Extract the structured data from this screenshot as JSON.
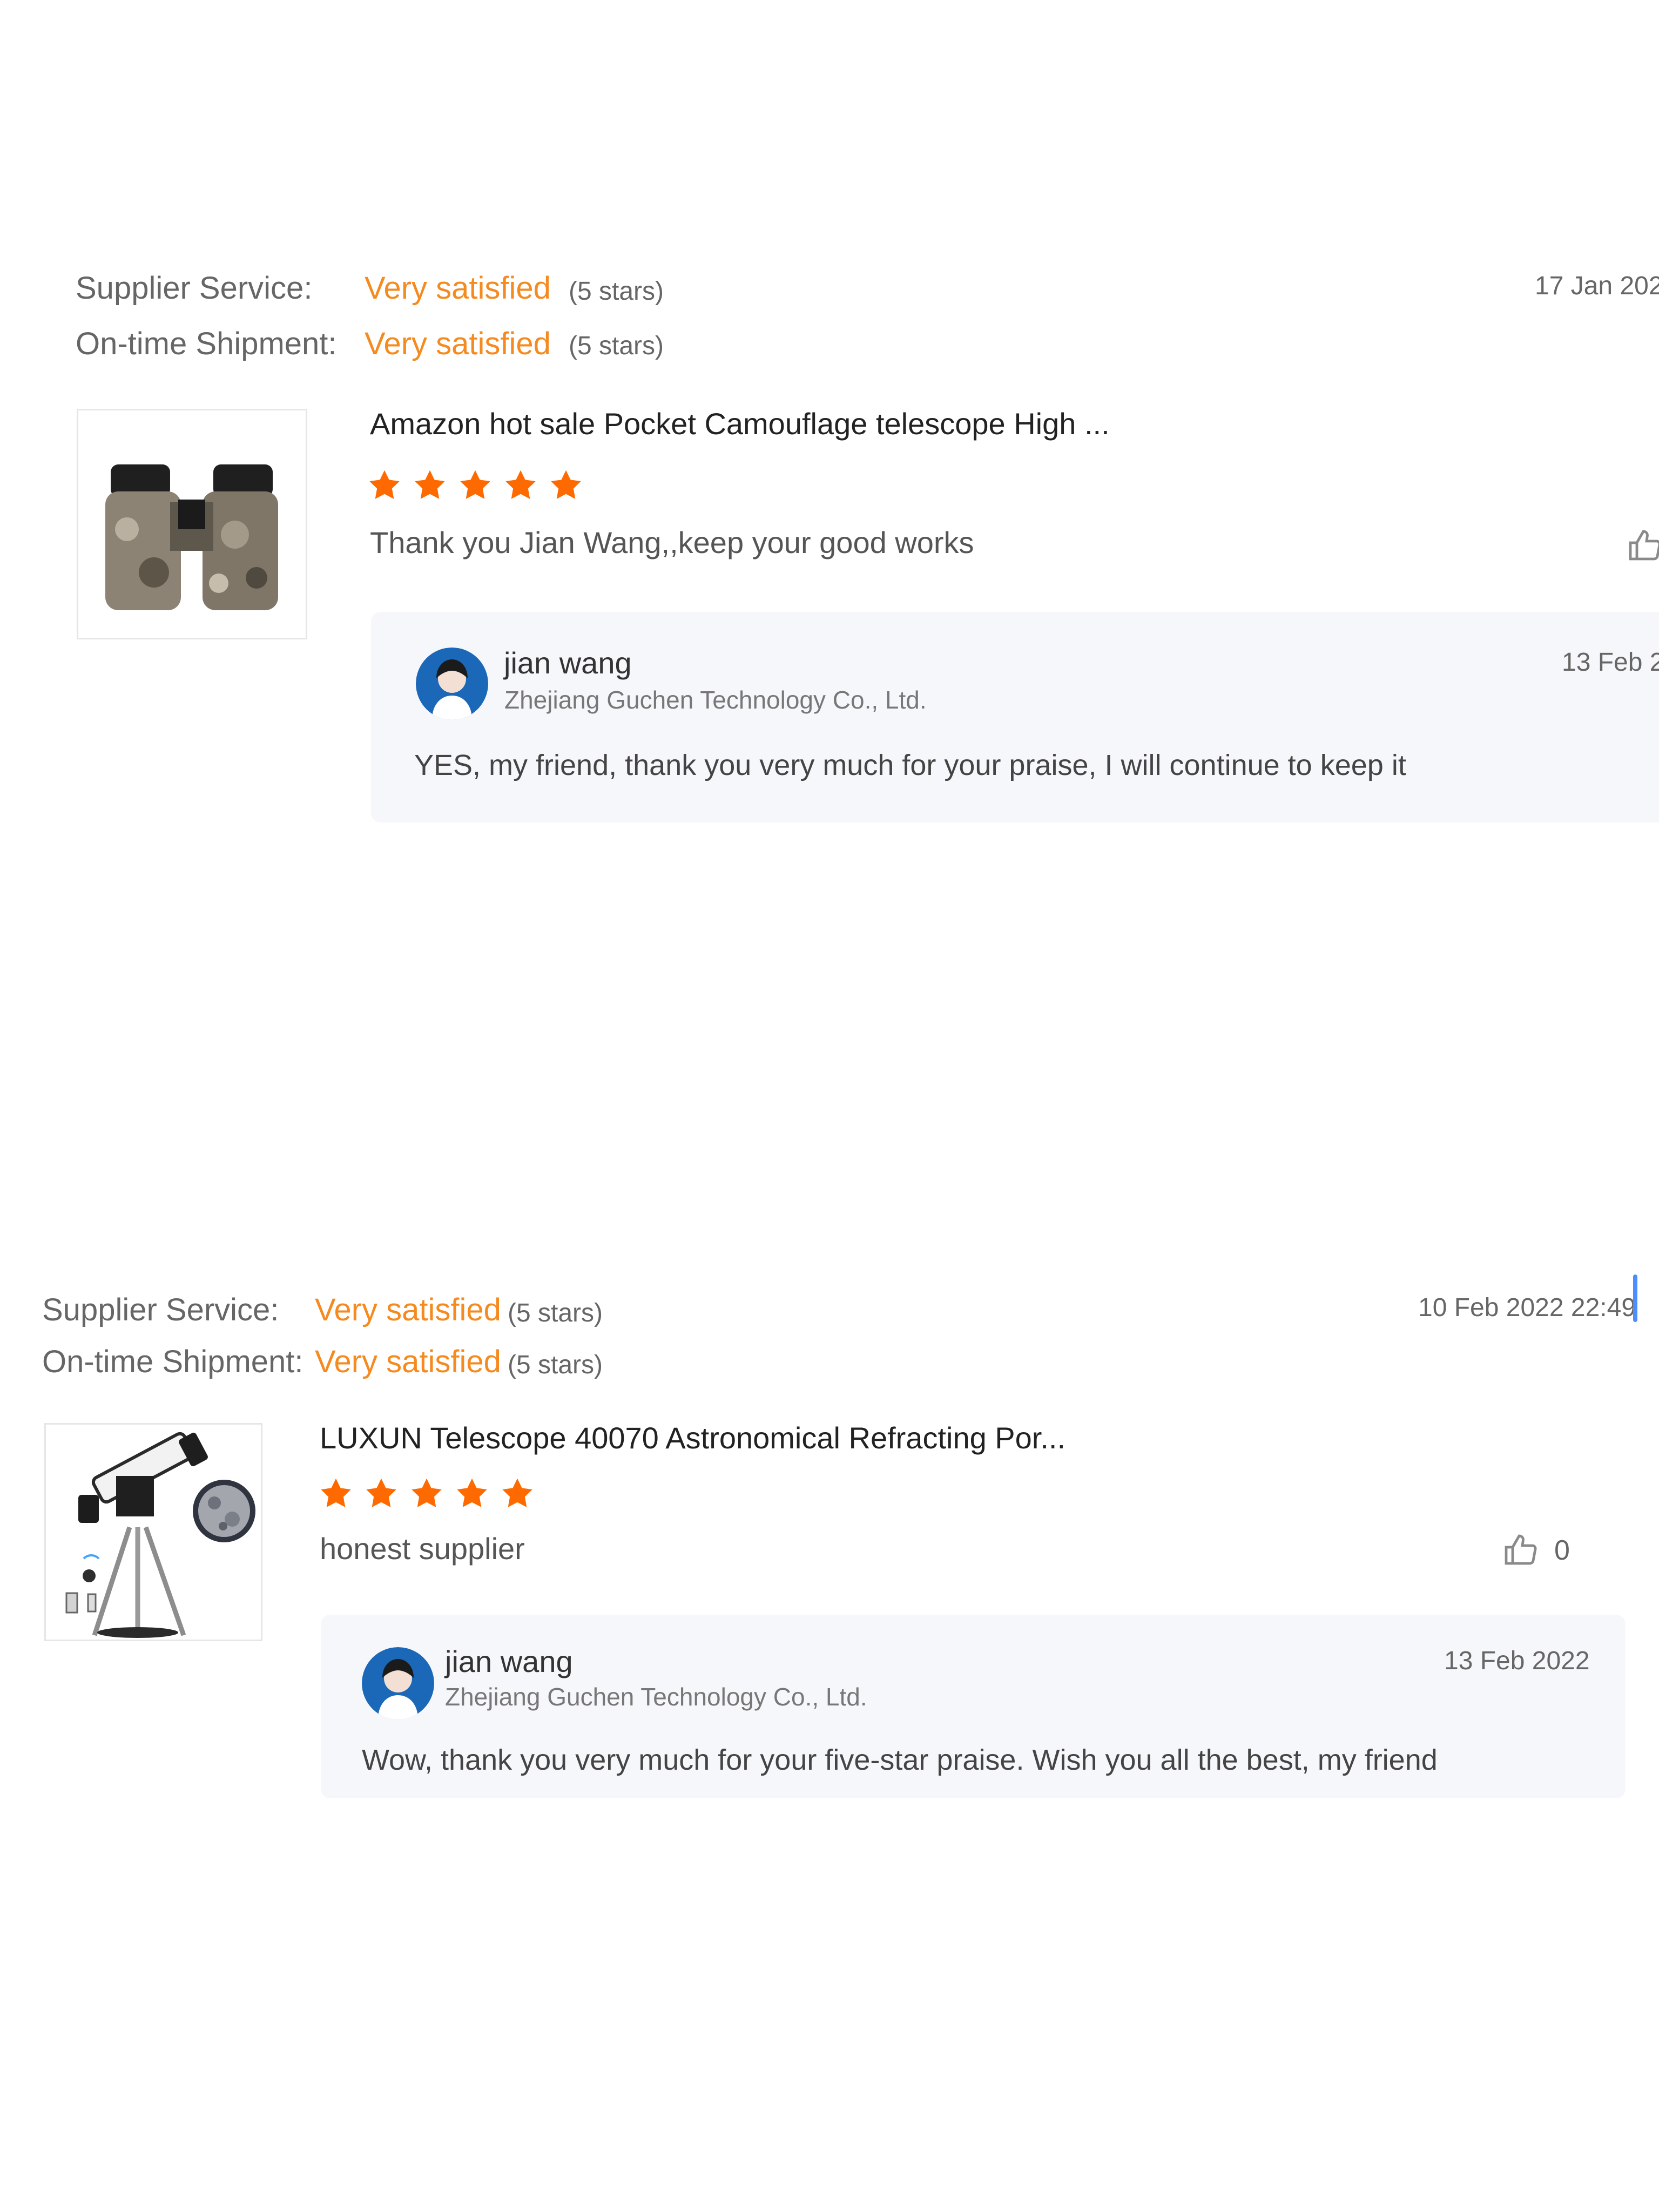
{
  "reviews": [
    {
      "supplier_service_label": "Supplier Service:",
      "supplier_service_rating": "Very satisfied",
      "supplier_service_stars": "(5 stars)",
      "shipment_label": "On-time Shipment:",
      "shipment_rating": "Very satisfied",
      "shipment_stars": "(5 stars)",
      "date": "17 Jan 202",
      "product_title": "Amazon hot sale Pocket Camouflage telescope High ...",
      "star_count": 5,
      "comment": "Thank you Jian Wang,,keep your good works",
      "reply": {
        "name": "jian wang",
        "company": "Zhejiang Guchen Technology Co., Ltd.",
        "date": "13 Feb 2",
        "text": "YES, my friend, thank you very much for your praise, I will continue to keep it"
      }
    },
    {
      "supplier_service_label": "Supplier Service:",
      "supplier_service_rating": "Very satisfied",
      "supplier_service_stars": "(5 stars)",
      "shipment_label": "On-time Shipment:",
      "shipment_rating": "Very satisfied",
      "shipment_stars": "(5 stars)",
      "date": "10 Feb 2022 22:49",
      "product_title": "LUXUN Telescope 40070 Astronomical Refracting Por...",
      "star_count": 5,
      "comment": "honest supplier",
      "like_count": "0",
      "reply": {
        "name": "jian wang",
        "company": "Zhejiang Guchen Technology Co., Ltd.",
        "date": "13 Feb 2022",
        "text": "Wow, thank you very much for your five-star praise. Wish you all the best, my friend"
      }
    }
  ],
  "colors": {
    "accent_orange": "#f58a1f",
    "star_orange": "#ff6a00",
    "reply_bg": "#f6f7fa",
    "scroll_blue": "#4d8dff"
  },
  "icons": {
    "star": "star-icon",
    "like": "thumbs-up-icon"
  }
}
